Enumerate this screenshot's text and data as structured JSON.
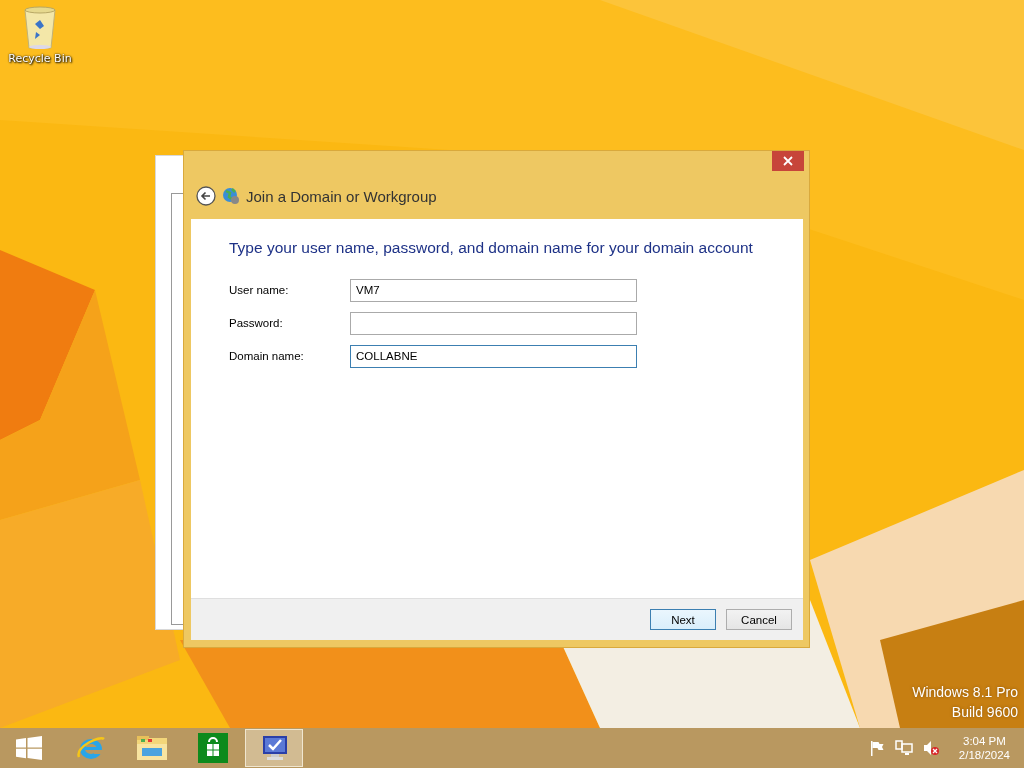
{
  "desktop": {
    "icons": [
      {
        "label": "Recycle Bin"
      }
    ],
    "watermark": [
      "Windows 8.1 Pro",
      "Build 9600"
    ]
  },
  "dialog": {
    "title": "Join a Domain or Workgroup",
    "heading": "Type your user name, password, and domain name for your domain account",
    "fields": [
      {
        "label": "User name:",
        "value": "VM7",
        "focused": false
      },
      {
        "label": "Password:",
        "focused": false
      },
      {
        "label": "Domain name:",
        "value": "COLLABNE",
        "focused": true
      }
    ],
    "buttons": [
      {
        "label": "Next",
        "default": true
      },
      {
        "label": "Cancel",
        "default": false
      }
    ]
  },
  "taskbar": {
    "apps": [
      {
        "kind": "start",
        "selected": false
      },
      {
        "kind": "browser",
        "selected": false
      },
      {
        "kind": "explorer",
        "selected": false
      },
      {
        "kind": "store",
        "selected": false
      },
      {
        "kind": "control-panel",
        "selected": true
      }
    ],
    "tray": [
      {
        "kind": "flag"
      },
      {
        "kind": "network"
      },
      {
        "kind": "volume-muted"
      }
    ],
    "time": "3:04 PM",
    "date": "2/18/2024"
  }
}
